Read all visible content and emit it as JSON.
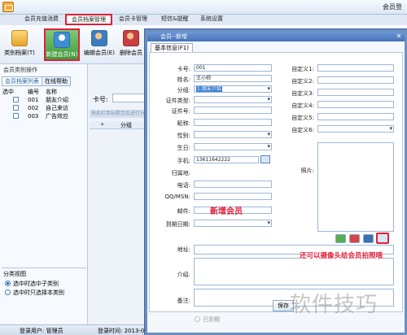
{
  "titlebar": {
    "user_label": "会员登"
  },
  "menu": [
    {
      "label": "会员充值消费"
    },
    {
      "label": "会员档案管理"
    },
    {
      "label": "会员卡管理"
    },
    {
      "label": "短信&提醒"
    },
    {
      "label": "系统设置"
    }
  ],
  "toolbar": [
    {
      "label": "类别档案(T)",
      "icon": "folder-icon"
    },
    {
      "label": "新建会员(N)",
      "icon": "add-member-icon"
    },
    {
      "label": "编辑会员(E)",
      "icon": "edit-member-icon"
    },
    {
      "label": "删除会员",
      "icon": "delete-member-icon"
    }
  ],
  "left": {
    "title": "会员类别操作",
    "tabs": [
      {
        "label": "会员档案列表"
      },
      {
        "label": "在线帮助"
      }
    ],
    "columns": [
      "选中",
      "编号",
      "名称"
    ],
    "rows": [
      {
        "id": "001",
        "name": "朋友介绍"
      },
      {
        "id": "002",
        "name": "自己来访"
      },
      {
        "id": "003",
        "name": "广告效应"
      }
    ],
    "view_title": "分类视图",
    "view_options": [
      {
        "label": "选中时选中子类别"
      },
      {
        "label": "选中时只选择本类别"
      }
    ]
  },
  "middle": {
    "card_label": "卡号:",
    "hint": "拖此栏目标题至此进行分组",
    "col_star": "*",
    "col_group": "分组"
  },
  "status": {
    "user": "登录用户: 管理员",
    "time": "登录时间: 2013-0"
  },
  "dialog": {
    "title": "会员--新增",
    "tab": "基本信息(F1)",
    "fields_left": [
      {
        "label": "卡号:",
        "value": "001"
      },
      {
        "label": "姓名:",
        "value": "王小帅"
      },
      {
        "label": "分组:",
        "value": "1:朋友介绍"
      },
      {
        "label": "证件类型:",
        "value": ""
      },
      {
        "label": "证件号:",
        "value": ""
      },
      {
        "label": "昵称:",
        "value": ""
      },
      {
        "label": "性别:",
        "value": ""
      },
      {
        "label": "生日:",
        "value": ""
      },
      {
        "label": "手机:",
        "value": "13611642222"
      },
      {
        "label": "归属地:",
        "value": ""
      },
      {
        "label": "电话:",
        "value": ""
      },
      {
        "label": "QQ/MSN:",
        "value": ""
      },
      {
        "label": "邮件:",
        "value": ""
      },
      {
        "label": "到期日期:",
        "value": ""
      }
    ],
    "fields_right": [
      {
        "label": "自定义1:"
      },
      {
        "label": "自定义2:"
      },
      {
        "label": "自定义3:"
      },
      {
        "label": "自定义4:"
      },
      {
        "label": "自定义5:"
      },
      {
        "label": "自定义6:"
      }
    ],
    "photo_label": "照片:",
    "address_label": "地址:",
    "intro_label": "介绍:",
    "remark_label": "备注:",
    "expired_label": "已到期",
    "save_label": "保存",
    "annotation_new": "新增会员",
    "annotation_photo": "还可以摄像头给会员拍照哦"
  },
  "watermark": "软件技巧",
  "colors": {
    "accent_red": "#e0203a",
    "title_blue": "#4572b8"
  }
}
